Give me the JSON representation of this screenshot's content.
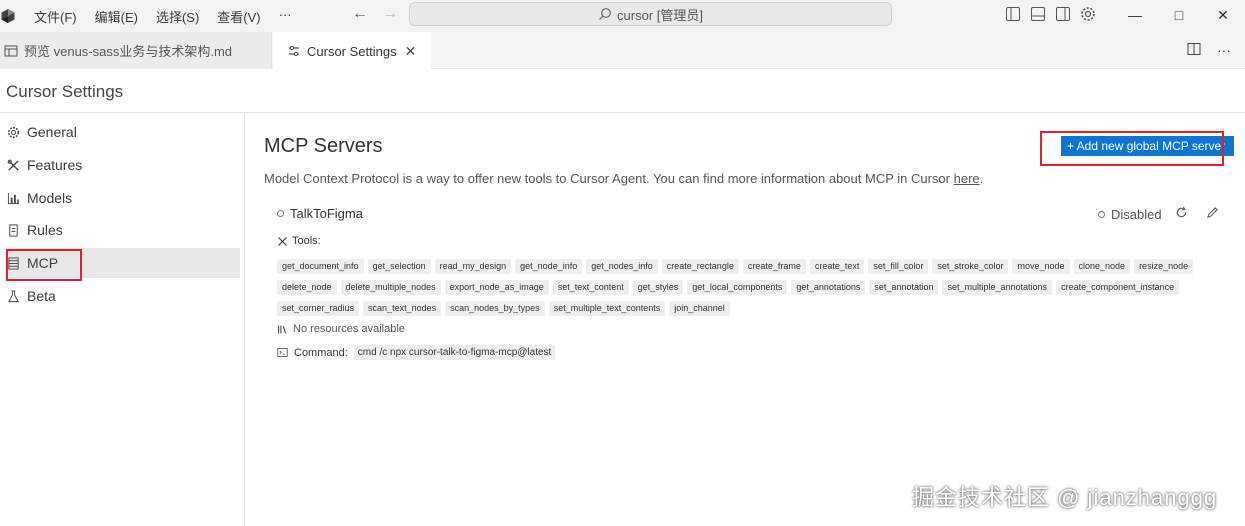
{
  "titlebar": {
    "menu": [
      "文件(F)",
      "编辑(E)",
      "选择(S)",
      "查看(V)",
      "···"
    ],
    "search_text": "cursor [管理员]"
  },
  "tabs": [
    {
      "label": "预览 venus-sass业务与技术架构.md"
    },
    {
      "label": "Cursor Settings"
    }
  ],
  "settings": {
    "title": "Cursor Settings"
  },
  "sidebar": {
    "items": [
      {
        "label": "General",
        "icon": "gear-icon"
      },
      {
        "label": "Features",
        "icon": "tools-icon"
      },
      {
        "label": "Models",
        "icon": "bar-chart-icon"
      },
      {
        "label": "Rules",
        "icon": "document-icon"
      },
      {
        "label": "MCP",
        "icon": "server-icon",
        "active": true
      },
      {
        "label": "Beta",
        "icon": "flask-icon"
      }
    ]
  },
  "main": {
    "title": "MCP Servers",
    "description": "Model Context Protocol is a way to offer new tools to Cursor Agent. You can find more information about MCP in Cursor",
    "link_text": "here",
    "link_suffix": ".",
    "add_button": "+ Add new global MCP server"
  },
  "server": {
    "name": "TalkToFigma",
    "status": "Disabled",
    "tools_label": "Tools:",
    "tools": [
      "get_document_info",
      "get_selection",
      "read_my_design",
      "get_node_info",
      "get_nodes_info",
      "create_rectangle",
      "create_frame",
      "create_text",
      "set_fill_color",
      "set_stroke_color",
      "move_node",
      "clone_node",
      "resize_node",
      "delete_node",
      "delete_multiple_nodes",
      "export_node_as_image",
      "set_text_content",
      "get_styles",
      "get_local_components",
      "get_annotations",
      "set_annotation",
      "set_multiple_annotations",
      "create_component_instance",
      "set_corner_radius",
      "scan_text_nodes",
      "scan_nodes_by_types",
      "set_multiple_text_contents",
      "join_channel"
    ],
    "resources_text": "No resources available",
    "command_label": "Command:",
    "command_value": "cmd /c npx cursor-talk-to-figma-mcp@latest"
  },
  "watermark": "掘金技术社区 @ jianzhanggg",
  "colors": {
    "accent": "#0e75d3",
    "highlight_box": "#e4212a"
  }
}
